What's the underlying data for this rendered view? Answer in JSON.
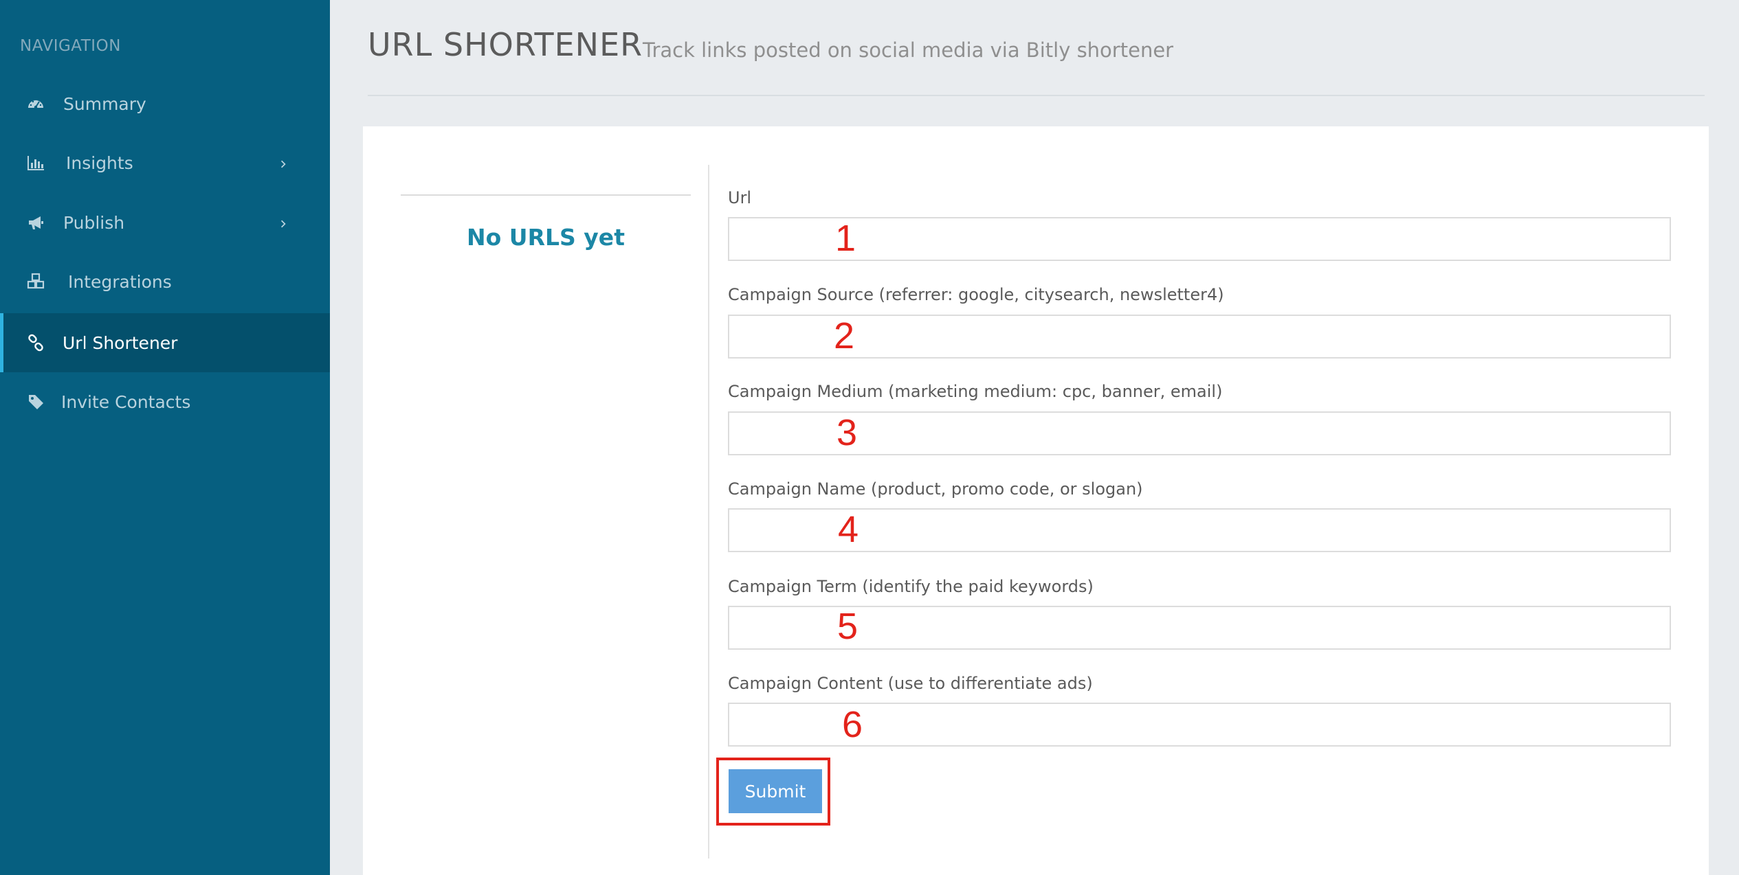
{
  "sidebar": {
    "heading": "NAVIGATION",
    "items": [
      {
        "label": "Summary",
        "icon": "dashboard-icon",
        "active": false,
        "has_caret": false
      },
      {
        "label": "Insights",
        "icon": "bar-chart-icon",
        "active": false,
        "has_caret": true
      },
      {
        "label": "Publish",
        "icon": "bullhorn-icon",
        "active": false,
        "has_caret": true
      },
      {
        "label": "Integrations",
        "icon": "cubes-icon",
        "active": false,
        "has_caret": false
      },
      {
        "label": "Url Shortener",
        "icon": "link-icon",
        "active": true,
        "has_caret": false
      },
      {
        "label": "Invite Contacts",
        "icon": "tag-icon",
        "active": false,
        "has_caret": false
      }
    ]
  },
  "header": {
    "title": "URL SHORTENER",
    "subtitle": "Track links posted on social media via Bitly shortener"
  },
  "urls_panel": {
    "empty_text": "No URLS yet"
  },
  "form": {
    "fields": [
      {
        "label": "Url",
        "value": "",
        "annotation": "1"
      },
      {
        "label": "Campaign Source (referrer: google, citysearch, newsletter4)",
        "value": "",
        "annotation": "2"
      },
      {
        "label": "Campaign Medium (marketing medium: cpc, banner, email)",
        "value": "",
        "annotation": "3"
      },
      {
        "label": "Campaign Name (product, promo code, or slogan)",
        "value": "",
        "annotation": "4"
      },
      {
        "label": "Campaign Term (identify the paid keywords)",
        "value": "",
        "annotation": "5"
      },
      {
        "label": "Campaign Content (use to differentiate ads)",
        "value": "",
        "annotation": "6"
      }
    ],
    "submit_label": "Submit"
  },
  "colors": {
    "sidebar_bg": "#065f80",
    "sidebar_active_bg": "#04506c",
    "accent": "#1c87a6",
    "button": "#5b9fdd",
    "annotation": "#e3231b"
  }
}
